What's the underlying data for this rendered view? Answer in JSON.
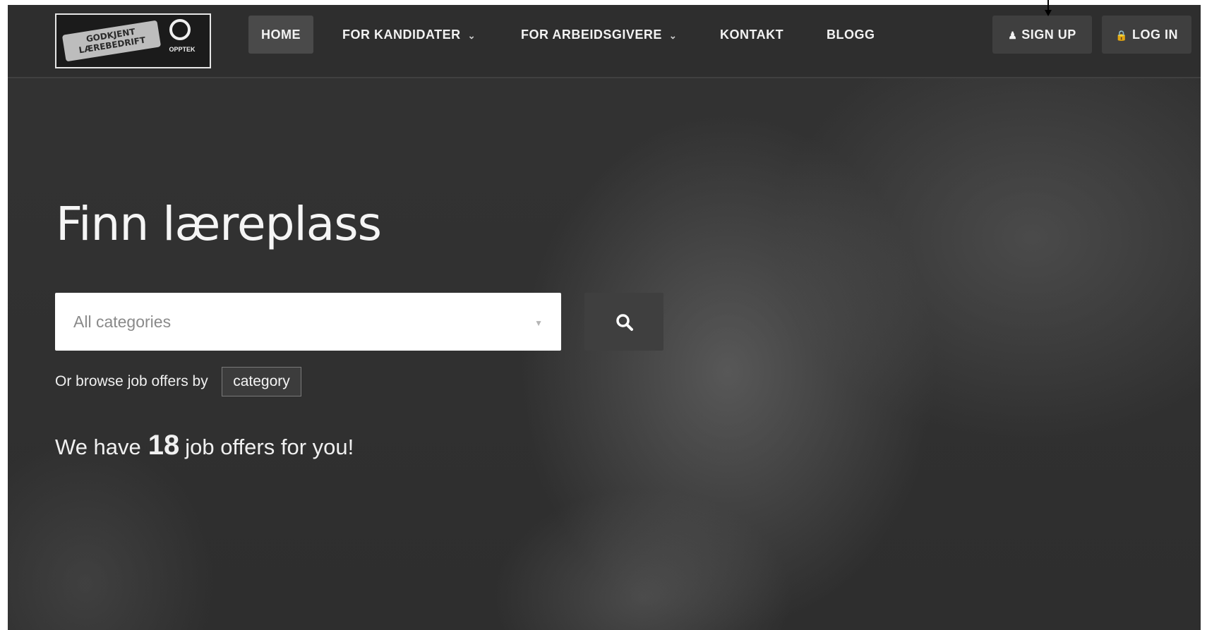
{
  "nav": {
    "items": [
      {
        "label": "HOME",
        "has_dropdown": false,
        "active": true
      },
      {
        "label": "FOR KANDIDATER",
        "has_dropdown": true,
        "active": false
      },
      {
        "label": "FOR ARBEIDSGIVERE",
        "has_dropdown": true,
        "active": false
      },
      {
        "label": "KONTAKT",
        "has_dropdown": false,
        "active": false
      },
      {
        "label": "BLOGG",
        "has_dropdown": false,
        "active": false
      }
    ],
    "signup_label": "SIGN UP",
    "signup_icon": "user-icon",
    "login_label": "LOG IN",
    "login_icon": "lock-icon"
  },
  "logo": {
    "badge_line1": "GODKJENT",
    "badge_line2": "LÆREBEDRIFT",
    "brand": "OPPTEK"
  },
  "hero": {
    "title": "Finn læreplass",
    "select_value": "All categories",
    "search_icon": "search-icon",
    "browse_prefix": "Or browse job offers by",
    "browse_button": "category",
    "offers_prefix": "We have",
    "offers_count": "18",
    "offers_suffix": "job offers for you!"
  },
  "colors": {
    "navbar_bg": "#2e2e2e",
    "active_item_bg": "#4a4a4a",
    "button_bg": "#3f3f3f",
    "text": "#f2f2f2",
    "input_bg": "#ffffff",
    "placeholder_text": "#8a8a8a"
  }
}
